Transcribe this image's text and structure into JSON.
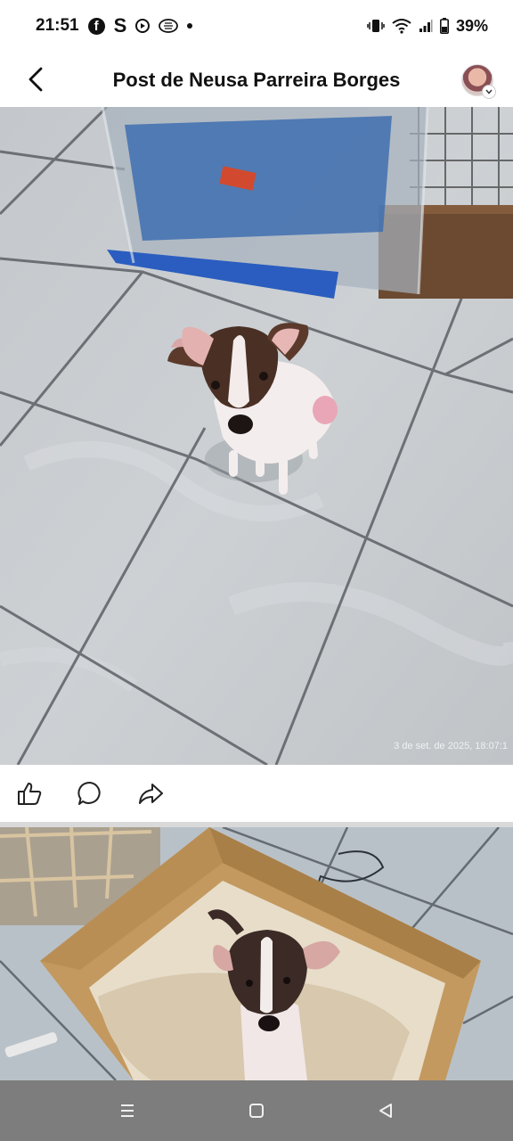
{
  "status_bar": {
    "time": "21:51",
    "facebook_glyph": "f",
    "s_glyph": "S",
    "battery": "39%",
    "icons": [
      "facebook-icon",
      "s-app-icon",
      "media-icon",
      "chat-bubble-icon",
      "notification-dot",
      "vibrate-icon",
      "wifi-icon",
      "signal-icon",
      "battery-icon"
    ]
  },
  "header": {
    "title": "Post de Neusa Parreira Borges",
    "back_icon": "chevron-left-icon",
    "avatar_icon": "avatar"
  },
  "post": {
    "photo_timestamp": "3 de set. de 2025, 18:07:1",
    "actions": [
      "like-icon",
      "comment-icon",
      "share-icon"
    ]
  },
  "nav_bar": {
    "buttons": [
      "recents-icon",
      "home-icon",
      "back-icon"
    ]
  },
  "colors": {
    "nav_bar": "#7d7d7d",
    "divider": "#d9d9d9",
    "text": "#111111"
  }
}
